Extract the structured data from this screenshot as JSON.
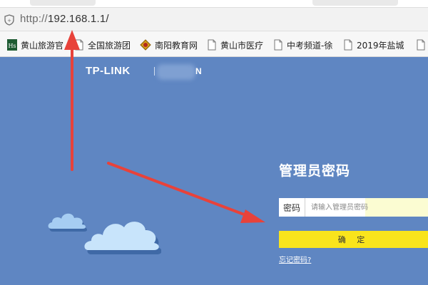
{
  "browser": {
    "url_protocol": "http://",
    "url_host": "192.168.1.1/"
  },
  "bookmarks": [
    {
      "label": "黄山旅游官",
      "icon": "hs-logo-icon"
    },
    {
      "label": "全国旅游团",
      "icon": "page-icon"
    },
    {
      "label": "南阳教育网",
      "icon": "emblem-icon"
    },
    {
      "label": "黄山市医疗",
      "icon": "page-icon"
    },
    {
      "label": "中考频道-徐",
      "icon": "page-icon"
    },
    {
      "label": "2019年盐城",
      "icon": "page-icon"
    },
    {
      "label": "",
      "icon": "page-icon"
    }
  ],
  "router_page": {
    "brand": "TP-LINK",
    "brand_suffix": "N",
    "title": "管理员密码",
    "password_label": "密码",
    "password_placeholder": "请输入管理员密码",
    "confirm_label": "确 定",
    "forgot_link": "忘记密码?",
    "colors": {
      "background": "#5f86c2",
      "confirm_button": "#f9e41c",
      "input_autofill": "#fbfcd2",
      "arrow": "#e8423a"
    }
  }
}
